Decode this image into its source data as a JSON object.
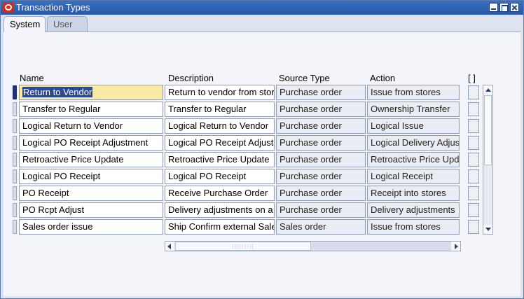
{
  "window": {
    "title": "Transaction Types",
    "icon": "oracle-icon"
  },
  "tabs": [
    {
      "label": "System",
      "active": true
    },
    {
      "label": "User",
      "active": false
    }
  ],
  "table": {
    "headers": {
      "name": "Name",
      "description": "Description",
      "source_type": "Source Type",
      "action": "Action",
      "flag": "[ ]"
    },
    "rows": [
      {
        "name": "Return to Vendor",
        "description": "Return to vendor from stores",
        "source_type": "Purchase order",
        "action": "Issue from stores"
      },
      {
        "name": "Transfer to Regular",
        "description": "Transfer to Regular",
        "source_type": "Purchase order",
        "action": "Ownership Transfer"
      },
      {
        "name": "Logical Return to Vendor",
        "description": "Logical Return to Vendor",
        "source_type": "Purchase order",
        "action": "Logical Issue"
      },
      {
        "name": "Logical PO Receipt Adjustment",
        "description": "Logical PO Receipt Adjustment",
        "source_type": "Purchase order",
        "action": "Logical Delivery Adjustment"
      },
      {
        "name": "Retroactive Price Update",
        "description": "Retroactive Price Update",
        "source_type": "Purchase order",
        "action": "Retroactive Price Update"
      },
      {
        "name": "Logical PO Receipt",
        "description": "Logical PO Receipt",
        "source_type": "Purchase order",
        "action": "Logical Receipt"
      },
      {
        "name": "PO Receipt",
        "description": "Receive Purchase Order",
        "source_type": "Purchase order",
        "action": "Receipt into stores"
      },
      {
        "name": "PO Rcpt Adjust",
        "description": "Delivery adjustments on a PO",
        "source_type": "Purchase order",
        "action": "Delivery adjustments"
      },
      {
        "name": "Sales order issue",
        "description": "Ship Confirm external Sales Order",
        "source_type": "Sales order",
        "action": "Issue from stores"
      }
    ]
  },
  "colors": {
    "titlebar": "#2858a8",
    "active_cell": "#fbeaa6",
    "current_record": "#1c2f7a"
  }
}
